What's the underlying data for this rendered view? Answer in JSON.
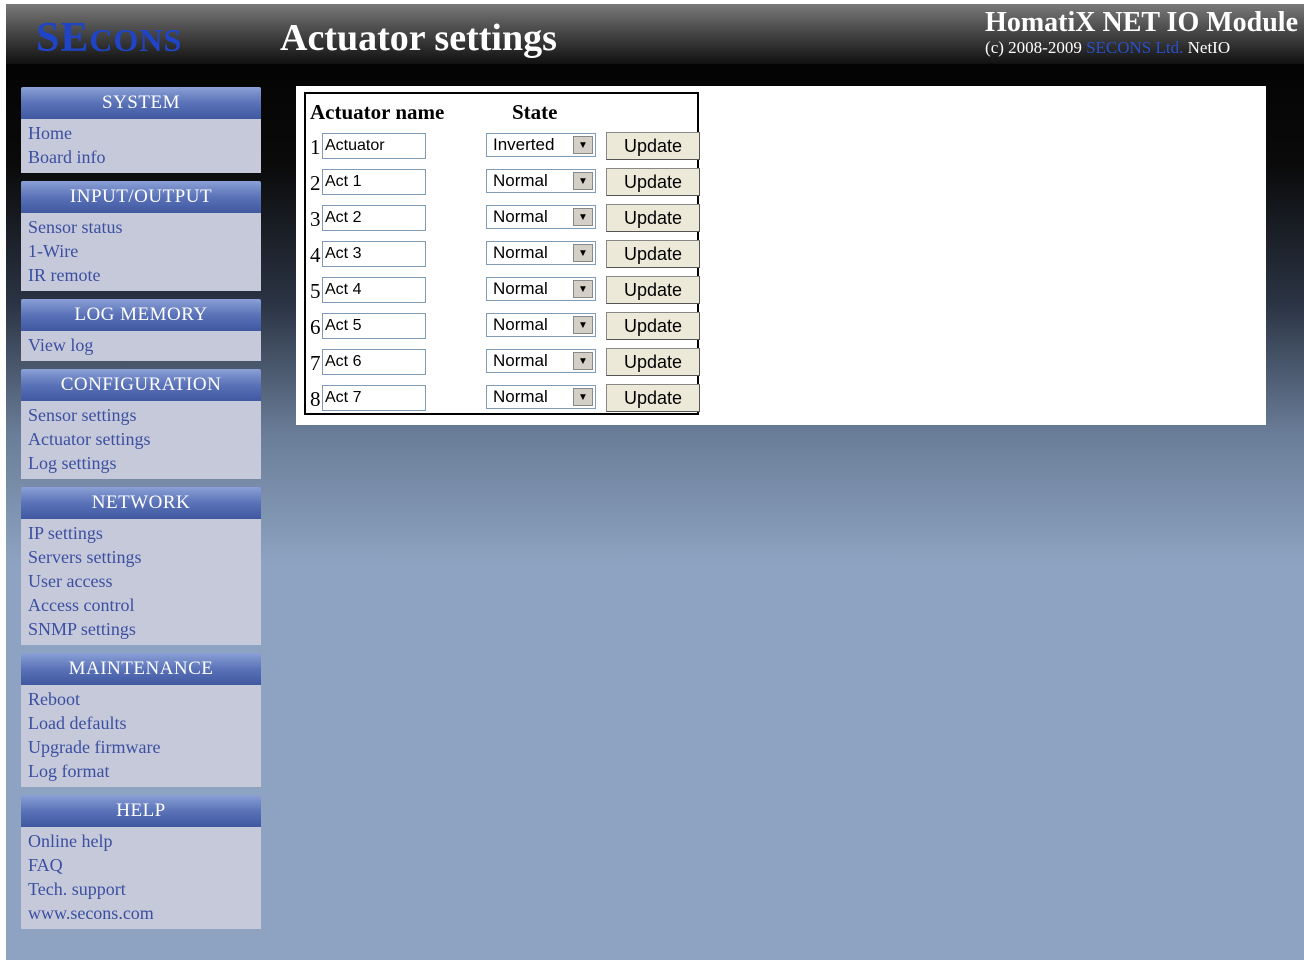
{
  "header": {
    "logo_main": "SE",
    "logo_small": "C",
    "logo_rest": "ONS",
    "page_title": "Actuator settings",
    "product_title": "HomatiX NET IO Module",
    "copyright_prefix": "(c) 2008-2009",
    "copyright_brand": "SECONS Ltd.",
    "copyright_suffix": "NetIO"
  },
  "sidebar": [
    {
      "title": "SYSTEM",
      "items": [
        "Home",
        "Board info"
      ]
    },
    {
      "title": "INPUT/OUTPUT",
      "items": [
        "Sensor status",
        "1-Wire",
        "IR remote"
      ]
    },
    {
      "title": "LOG MEMORY",
      "items": [
        "View log"
      ]
    },
    {
      "title": "CONFIGURATION",
      "items": [
        "Sensor settings",
        "Actuator settings",
        "Log settings"
      ]
    },
    {
      "title": "NETWORK",
      "items": [
        "IP settings",
        "Servers settings",
        "User access",
        "Access control",
        "SNMP settings"
      ]
    },
    {
      "title": "MAINTENANCE",
      "items": [
        "Reboot",
        "Load defaults",
        "Upgrade firmware",
        "Log format"
      ]
    },
    {
      "title": "HELP",
      "items": [
        "Online help",
        "FAQ",
        "Tech. support",
        "www.secons.com"
      ]
    }
  ],
  "table": {
    "col_name": "Actuator name",
    "col_state": "State",
    "button_label": "Update",
    "rows": [
      {
        "num": "1",
        "name": "Actuator",
        "state": "Inverted"
      },
      {
        "num": "2",
        "name": "Act 1",
        "state": "Normal"
      },
      {
        "num": "3",
        "name": "Act 2",
        "state": "Normal"
      },
      {
        "num": "4",
        "name": "Act 3",
        "state": "Normal"
      },
      {
        "num": "5",
        "name": "Act 4",
        "state": "Normal"
      },
      {
        "num": "6",
        "name": "Act 5",
        "state": "Normal"
      },
      {
        "num": "7",
        "name": "Act 6",
        "state": "Normal"
      },
      {
        "num": "8",
        "name": "Act 7",
        "state": "Normal"
      }
    ]
  },
  "colors": {
    "brand_blue": "#1f44c8",
    "menu_link": "#3a4fa0",
    "menu_bg": "#c6c9da",
    "menu_head": "#4b64aa"
  }
}
